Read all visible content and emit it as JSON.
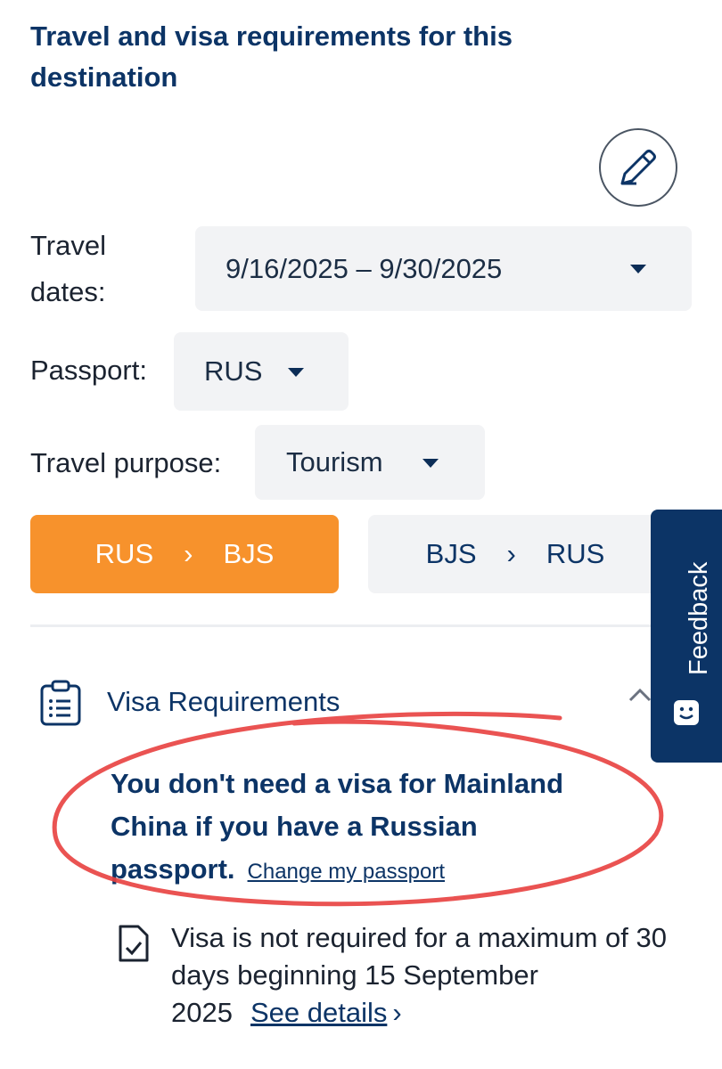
{
  "header": {
    "title": "Travel and visa requirements for this destination"
  },
  "form": {
    "dates_label": "Travel dates:",
    "dates_value": "9/16/2025 – 9/30/2025",
    "passport_label": "Passport:",
    "passport_value": "RUS",
    "purpose_label": "Travel purpose:",
    "purpose_value": "Tourism"
  },
  "direction": {
    "outbound": {
      "from": "RUS",
      "to": "BJS"
    },
    "inbound": {
      "from": "BJS",
      "to": "RUS"
    }
  },
  "feedback": {
    "label": "Feedback"
  },
  "visa": {
    "section_title": "Visa Requirements",
    "message": "You don't need a visa for Mainland China if you have a Russian passport.",
    "change_link": "Change my passport",
    "detail": "Visa is not required for a maximum of 30 days beginning 15 September 2025",
    "see_details": "See details"
  },
  "colors": {
    "primary": "#0c3466",
    "accent": "#f7922c",
    "annotation": "#e8403f"
  }
}
